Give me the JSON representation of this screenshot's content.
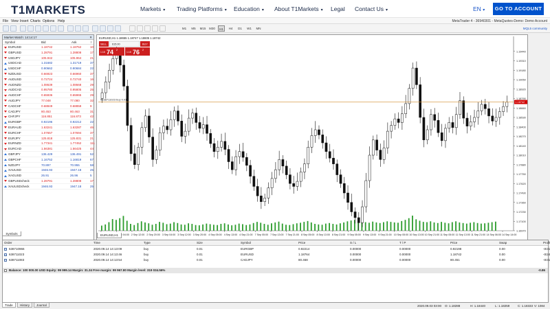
{
  "site": {
    "logo": "T1MARKETS",
    "nav": [
      {
        "label": "Markets",
        "caret": true
      },
      {
        "label": "Trading Platforms",
        "caret": true
      },
      {
        "label": "Education",
        "caret": true
      },
      {
        "label": "About T1Markets",
        "caret": true
      },
      {
        "label": "Legal",
        "caret": false
      },
      {
        "label": "Contact Us",
        "caret": true
      }
    ],
    "language": "EN",
    "cta": "GO TO ACCOUNT"
  },
  "platform": {
    "menu": [
      "File",
      "View",
      "Insert",
      "Charts",
      "Options",
      "Help"
    ],
    "window_title": "MetaTrader 4 - 36940301 - MetaQuotes-Demo: Demo Account",
    "timeframes": [
      "M1",
      "M5",
      "M15",
      "M30",
      "H1",
      "H4",
      "D1",
      "W1",
      "MN"
    ],
    "active_timeframe": "H1",
    "mql5_link": "MQL5 community"
  },
  "market_watch": {
    "title": "Market Watch: 14:14:17",
    "headers": {
      "symbol": "Symbol",
      "bid": "Bid",
      "ask": "Ask",
      "spread": "!"
    },
    "rows": [
      {
        "symbol": "EURUSD",
        "bid": "1.18742",
        "ask": "1.18752",
        "spread": "10",
        "dir": "down"
      },
      {
        "symbol": "GBPUSD",
        "bid": "1.28791",
        "ask": "1.28808",
        "spread": "17",
        "dir": "down"
      },
      {
        "symbol": "USDJPY",
        "bid": "105.942",
        "ask": "105.964",
        "spread": "21",
        "dir": "down"
      },
      {
        "symbol": "USDCAD",
        "bid": "1.31682",
        "ask": "1.31719",
        "spread": "37",
        "dir": "up"
      },
      {
        "symbol": "USDCHF",
        "bid": "0.90662",
        "ask": "0.90684",
        "spread": "22",
        "dir": "up"
      },
      {
        "symbol": "NZDUSD",
        "bid": "0.66923",
        "ask": "0.66960",
        "spread": "37",
        "dir": "down"
      },
      {
        "symbol": "AUDUSD",
        "bid": "0.72724",
        "ask": "0.72740",
        "spread": "16",
        "dir": "down"
      },
      {
        "symbol": "AUDNZD",
        "bid": "1.08639",
        "ask": "1.08668",
        "spread": "29",
        "dir": "down"
      },
      {
        "symbol": "AUDCAD",
        "bid": "0.95780",
        "ask": "0.95805",
        "spread": "25",
        "dir": "down"
      },
      {
        "symbol": "AUDCHF",
        "bid": "0.65936",
        "ask": "0.65965",
        "spread": "29",
        "dir": "down"
      },
      {
        "symbol": "AUDJPY",
        "bid": "77.048",
        "ask": "77.080",
        "spread": "32",
        "dir": "down"
      },
      {
        "symbol": "CADCHF",
        "bid": "0.68849",
        "ask": "0.68858",
        "spread": "9",
        "dir": "down"
      },
      {
        "symbol": "CADJPY",
        "bid": "80.453",
        "ask": "80.463",
        "spread": "31",
        "dir": "down"
      },
      {
        "symbol": "CHFJPY",
        "bid": "116.851",
        "ask": "116.873",
        "spread": "42",
        "dir": "down"
      },
      {
        "symbol": "EURGBP",
        "bid": "0.92196",
        "ask": "0.92212",
        "spread": "22",
        "dir": "up"
      },
      {
        "symbol": "EURAUD",
        "bid": "1.63241",
        "ask": "1.63287",
        "spread": "46",
        "dir": "down"
      },
      {
        "symbol": "EURCHF",
        "bid": "1.07657",
        "ask": "1.07694",
        "spread": "37",
        "dir": "down"
      },
      {
        "symbol": "EURJPY",
        "bid": "125.818",
        "ask": "125.831",
        "spread": "21",
        "dir": "down"
      },
      {
        "symbol": "EURNZD",
        "bid": "1.77341",
        "ask": "1.77452",
        "spread": "111",
        "dir": "down"
      },
      {
        "symbol": "EURCAD",
        "bid": "1.56381",
        "ask": "1.56425",
        "spread": "44",
        "dir": "down"
      },
      {
        "symbol": "GBPJPY",
        "bid": "136.429",
        "ask": "136.491",
        "spread": "52",
        "dir": "up"
      },
      {
        "symbol": "GBPCHF",
        "bid": "1.16752",
        "ask": "1.16819",
        "spread": "67",
        "dir": "up"
      },
      {
        "symbol": "NZDJPY",
        "bid": "70.897",
        "ask": "70.955",
        "spread": "58",
        "dir": "up"
      },
      {
        "symbol": "XAUUSD",
        "bid": "1946.93",
        "ask": "1947.18",
        "spread": "25",
        "dir": "up"
      },
      {
        "symbol": "XAGUSD",
        "bid": "26.91",
        "ask": "26.96",
        "spread": "5",
        "dir": "up"
      },
      {
        "symbol": "GBPUSDcheck",
        "bid": "1.28791",
        "ask": "1.28808",
        "spread": "17",
        "dir": "down"
      },
      {
        "symbol": "XAUUSDcheck",
        "bid": "1946.93",
        "ask": "1947.18",
        "spread": "25",
        "dir": "up"
      }
    ],
    "tab": "Symbols"
  },
  "chart": {
    "header": "EURUSD,H1 1.18655 1.18747 1.18605 1.18742",
    "one_click": {
      "sell_label": "SELL",
      "buy_label": "BUY",
      "lot": "615.00",
      "sell_small": "1.18",
      "sell_big": "74",
      "sell_sup": "2",
      "buy_small": "1.18",
      "buy_big": "76",
      "buy_sup": "2"
    },
    "order_line_label": "#638711023 buy 0.01",
    "price_marker": "1.18742",
    "tab": "EURUSD,H1",
    "colors": {
      "candle": "#111111",
      "volume": "#2e9d2e",
      "order_line": "#d28a2b",
      "price_marker": "#d00000",
      "sell": "#cc1f1f",
      "buy": "#cc1f1f"
    }
  },
  "chart_data": {
    "type": "candlestick",
    "symbol": "EURUSD",
    "timeframe": "H1",
    "ohlc_last": {
      "open": 1.18655,
      "high": 1.18747,
      "low": 1.18605,
      "close": 1.18742
    },
    "y_ticks": [
      "1.19440",
      "1.19310",
      "1.19180",
      "1.19050",
      "1.18920",
      "1.18790",
      "1.18660",
      "1.18530",
      "1.18400",
      "1.18270",
      "1.18140",
      "1.18010",
      "1.17880",
      "1.17750",
      "1.17620",
      "1.17490",
      "1.17360",
      "1.17230",
      "1.17100",
      "1.16970"
    ],
    "x_ticks": [
      "1 Sep 2020",
      "2 Sep 04:00",
      "2 Sep 12:00",
      "2 Sep 20:00",
      "3 Sep 04:00",
      "3 Sep 12:00",
      "3 Sep 20:00",
      "4 Sep 05:00",
      "4 Sep 13:00",
      "4 Sep 21:00",
      "7 Sep 05:00",
      "7 Sep 13:00",
      "7 Sep 21:00",
      "8 Sep 05:00",
      "8 Sep 13:00",
      "8 Sep 21:00",
      "9 Sep 05:00",
      "9 Sep 13:00",
      "9 Sep 21:00",
      "10 Sep 05:00",
      "10 Sep 13:00",
      "10 Sep 21:00",
      "11 Sep 05:00",
      "11 Sep 13:00",
      "11 Sep 21:00",
      "14 Sep 06:00",
      "14 Sep 14:00"
    ],
    "ylim": [
      1.1697,
      1.1957
    ],
    "order_price": 1.18742,
    "closes": [
      1.1887,
      1.1902,
      1.1918,
      1.1934,
      1.1941,
      1.1925,
      1.1896,
      1.1842,
      1.1803,
      1.1788,
      1.1812,
      1.1839,
      1.1855,
      1.1826,
      1.1795,
      1.1808,
      1.1832,
      1.1841,
      1.1836,
      1.185,
      1.1862,
      1.1848,
      1.1827,
      1.1834,
      1.1852,
      1.1859,
      1.1846,
      1.1838,
      1.1843,
      1.1831,
      1.1817,
      1.1806,
      1.1812,
      1.182,
      1.1809,
      1.1792,
      1.1781,
      1.1799,
      1.1806,
      1.1798,
      1.1787,
      1.1772,
      1.1758,
      1.1745,
      1.1737,
      1.1742,
      1.1756,
      1.1769,
      1.1781,
      1.1795,
      1.1786,
      1.1774,
      1.1762,
      1.1758,
      1.1765,
      1.1778,
      1.1789,
      1.1812,
      1.1828,
      1.1836,
      1.1829,
      1.1818,
      1.1806,
      1.1797,
      1.1789,
      1.1774,
      1.1762,
      1.1749,
      1.1736,
      1.1723,
      1.1715,
      1.1708,
      1.173,
      1.1766,
      1.1801,
      1.1822,
      1.1808,
      1.1795,
      1.1811,
      1.1834,
      1.1842,
      1.1851,
      1.1846,
      1.1858,
      1.1872,
      1.1893,
      1.1921,
      1.1898,
      1.1853,
      1.1822,
      1.1836,
      1.1857,
      1.1849,
      1.1832,
      1.1821,
      1.1838,
      1.1846,
      1.1839,
      1.1857,
      1.1876,
      1.1852,
      1.1841,
      1.1847,
      1.1853,
      1.1862,
      1.1871,
      1.1865,
      1.1855,
      1.1848,
      1.1853,
      1.1861,
      1.1868,
      1.1874
    ],
    "volumes": [
      18,
      22,
      30,
      41,
      38,
      44,
      52,
      35,
      24,
      20,
      27,
      33,
      29,
      26,
      21,
      24,
      31,
      28,
      23,
      25,
      30,
      27,
      22,
      21,
      26,
      24,
      20,
      19,
      22,
      25,
      23,
      21,
      20,
      24,
      26,
      22,
      19,
      21,
      25,
      23,
      20,
      22,
      27,
      31,
      28,
      24,
      21,
      26,
      29,
      32,
      25,
      21,
      20,
      23,
      26,
      28,
      31,
      34,
      29,
      24,
      22,
      21,
      25,
      27,
      24,
      22,
      26,
      29,
      33,
      36,
      38,
      41,
      35,
      30,
      28,
      32,
      29,
      27,
      30,
      33,
      31,
      29,
      28,
      34,
      38,
      44,
      53,
      40,
      35,
      31,
      30,
      33,
      29,
      27,
      31,
      28,
      26,
      30,
      33,
      29,
      27,
      25,
      28,
      30,
      27,
      25,
      26,
      28,
      30,
      32
    ]
  },
  "terminal": {
    "headers": [
      "Order",
      "Time",
      "Type",
      "Size",
      "Symbol",
      "Price",
      "S / L",
      "T / P",
      "Price",
      "Swap",
      "Profit"
    ],
    "orders": [
      {
        "order": "638710966",
        "time": "2020.09.14 14:13:09",
        "type": "buy",
        "size": "0.01",
        "symbol": "EURGBP",
        "price": "0.92214",
        "sl": "0.00000",
        "tp": "0.00000",
        "cur": "0.92198",
        "swap": "0.00",
        "profit": "-0.31"
      },
      {
        "order": "638711023",
        "time": "2020.09.14 14:13:46",
        "type": "buy",
        "size": "0.01",
        "symbol": "EURUSD",
        "price": "1.18764",
        "sl": "0.00000",
        "tp": "0.00000",
        "cur": "1.18742",
        "swap": "0.00",
        "profit": "-0.24"
      },
      {
        "order": "638711083",
        "time": "2020.09.14 14:13:54",
        "type": "buy",
        "size": "0.01",
        "symbol": "CADJPY",
        "price": "80.468",
        "sl": "0.00000",
        "tp": "0.00000",
        "cur": "80.451",
        "swap": "0.00",
        "profit": "-0.31"
      }
    ],
    "balance_line": "Balance: 100 000.00 USD  Equity: 99 999.14  Margin: 31.34  Free margin: 99 967.80  Margin level: 319 034.56%",
    "total_profit": "-0.86",
    "tabs": [
      "Trade",
      "History",
      "Journal"
    ],
    "active_tab": "Trade"
  },
  "status": {
    "datetime": "2020.09.03 03:00",
    "o": "O: 1.18288",
    "h": "H: 1.18440",
    "l": "L: 1.18259",
    "c": "C: 1.18333",
    "v": "V: 1084"
  }
}
